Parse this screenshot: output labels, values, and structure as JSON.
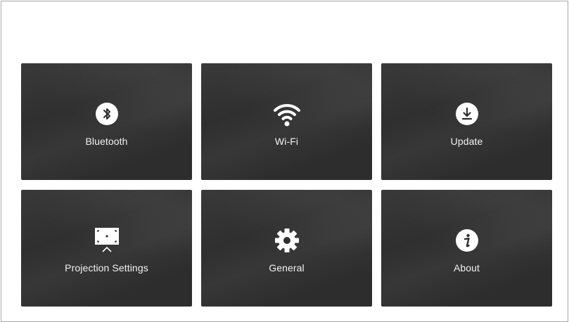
{
  "tiles": [
    {
      "label": "Bluetooth",
      "icon": "bluetooth-icon"
    },
    {
      "label": "Wi-Fi",
      "icon": "wifi-icon"
    },
    {
      "label": "Update",
      "icon": "download-icon"
    },
    {
      "label": "Projection Settings",
      "icon": "projection-screen-icon"
    },
    {
      "label": "General",
      "icon": "gear-icon"
    },
    {
      "label": "About",
      "icon": "info-icon"
    }
  ],
  "colors": {
    "tile_background": "#2f2f2f",
    "tile_text": "#f2f2f2",
    "page_background": "#ffffff",
    "frame_border": "#a9a9a9"
  }
}
